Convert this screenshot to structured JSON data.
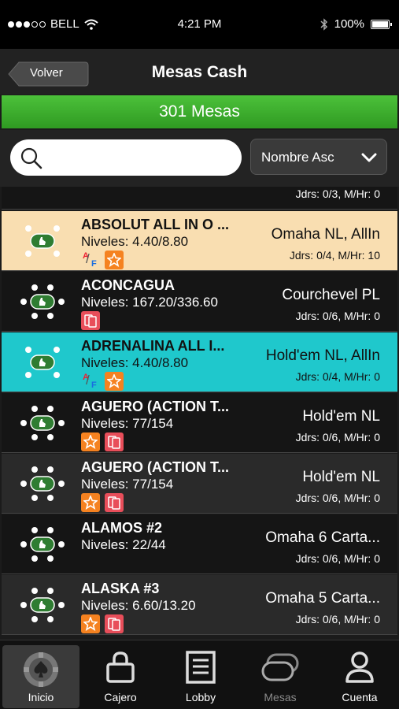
{
  "status": {
    "carrier": "BELL",
    "time": "4:21 PM",
    "battery": "100%",
    "signal_bars": 3
  },
  "nav": {
    "back_label": "Volver",
    "title": "Mesas Cash"
  },
  "banner": {
    "count_text": "301 Mesas"
  },
  "search": {
    "placeholder": "",
    "value": ""
  },
  "sort": {
    "selected": "Nombre Asc"
  },
  "partial_row": {
    "players": "Jdrs: 0/3, M/Hr: 0"
  },
  "tables": [
    {
      "name": "ABSOLUT ALL IN O ...",
      "levels": "Niveles: 4.40/8.80",
      "game": "Omaha NL, AllIn",
      "players": "Jdrs: 0/4, M/Hr: 10",
      "style": "highlight",
      "seats": 4,
      "badges": [
        "af",
        "star"
      ]
    },
    {
      "name": "ACONCAGUA",
      "levels": "Niveles: 167.20/336.60",
      "game": "Courchevel PL",
      "players": "Jdrs: 0/6, M/Hr: 0",
      "style": "dark",
      "seats": 6,
      "badges": [
        "book"
      ]
    },
    {
      "name": "ADRENALINA ALL I...",
      "levels": "Niveles: 4.40/8.80",
      "game": "Hold'em NL, AllIn",
      "players": "Jdrs: 0/4, M/Hr: 0",
      "style": "cyan",
      "seats": 4,
      "badges": [
        "af",
        "star"
      ]
    },
    {
      "name": "AGUERO (ACTION T...",
      "levels": "Niveles: 77/154",
      "game": "Hold'em NL",
      "players": "Jdrs: 0/6, M/Hr: 0",
      "style": "dark",
      "seats": 6,
      "badges": [
        "star",
        "book"
      ]
    },
    {
      "name": "AGUERO (ACTION T...",
      "levels": "Niveles: 77/154",
      "game": "Hold'em NL",
      "players": "Jdrs: 0/6, M/Hr: 0",
      "style": "gray",
      "seats": 6,
      "badges": [
        "star",
        "book"
      ]
    },
    {
      "name": "ALAMOS #2",
      "levels": "Niveles: 22/44",
      "game": "Omaha 6 Carta...",
      "players": "Jdrs: 0/6, M/Hr: 0",
      "style": "dark",
      "seats": 6,
      "badges": []
    },
    {
      "name": "ALASKA #3",
      "levels": "Niveles: 6.60/13.20",
      "game": "Omaha 5 Carta...",
      "players": "Jdrs: 0/6, M/Hr: 0",
      "style": "gray",
      "seats": 6,
      "badges": [
        "star",
        "book"
      ]
    }
  ],
  "tabs": [
    {
      "label": "Inicio",
      "icon": "poker-chip-icon",
      "active": true
    },
    {
      "label": "Cajero",
      "icon": "lock-icon",
      "active": false
    },
    {
      "label": "Lobby",
      "icon": "document-list-icon",
      "active": false
    },
    {
      "label": "Mesas",
      "icon": "stacked-tables-icon",
      "active": false,
      "dim": true
    },
    {
      "label": "Cuenta",
      "icon": "person-icon",
      "active": false
    }
  ],
  "colors": {
    "banner_green": "#3fb22e",
    "highlight_row": "#f9deb1",
    "cyan_row": "#1fc8cc",
    "badge_star": "#f58220",
    "badge_book": "#e84e5a",
    "table_felt": "#2f7d32"
  }
}
